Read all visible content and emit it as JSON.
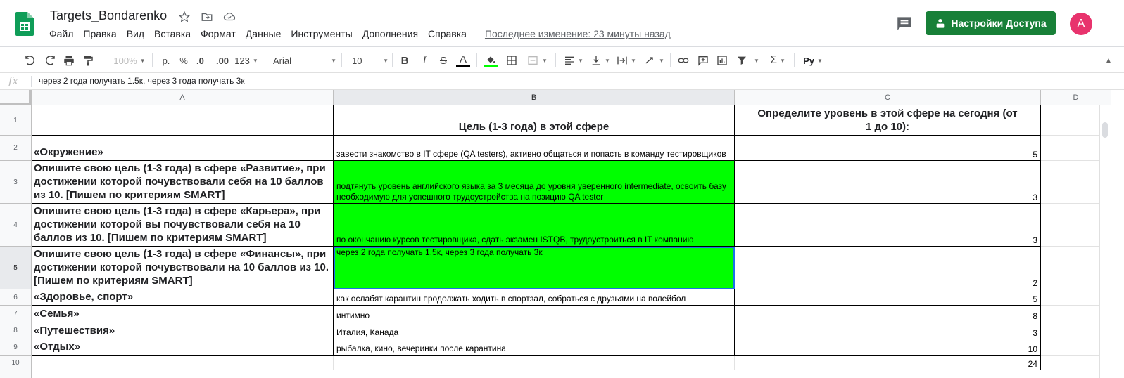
{
  "header": {
    "doc_title": "Targets_Bondarenko",
    "menus": [
      "Файл",
      "Правка",
      "Вид",
      "Вставка",
      "Формат",
      "Данные",
      "Инструменты",
      "Дополнения",
      "Справка"
    ],
    "last_edit": "Последнее изменение: 23 минуты назад",
    "share_label": "Настройки Доступа",
    "avatar_letter": "A",
    "colors": {
      "share": "#188038",
      "avatar": "#e8336d",
      "logo": "#0f9d58"
    }
  },
  "toolbar": {
    "zoom": "100%",
    "currency": "р.",
    "percent": "%",
    "dec_decrease": ".0_",
    "dec_increase": ".00",
    "more_formats": "123",
    "font": "Arial",
    "font_size": "10",
    "bold": "B",
    "italic": "I",
    "strike": "S",
    "text_color": "A",
    "input_tools": "Pу",
    "text_color_bar": "#000000",
    "fill_color_bar": "#00ff00"
  },
  "formula_bar": {
    "fx": "fx",
    "content": "через 2 года получать 1.5к, через 3 года получать 3к"
  },
  "columns": [
    "A",
    "B",
    "C",
    "D"
  ],
  "rows": [
    {
      "num": "1",
      "a": "",
      "b": "Цель (1-3 года) в этой сфере",
      "c": "Определите уровень в этой сфере на сегодня (от 1 до 10):"
    },
    {
      "num": "2",
      "a": "«Окружение»",
      "b": "завести знакомство в IT сфере (QA testers), активно общаться и попасть в команду тестировщиков",
      "c": "5"
    },
    {
      "num": "3",
      "a": "Опишите свою цель (1-3 года) в сфере «Развитие», при достижении которой почувствовали себя на 10 баллов из 10. [Пишем по критериям SMART]",
      "b": "подтянуть уровень английского языка за 3 месяца до уровня уверенного intermediate, освоить базу необходимую для успешного трудоустройства на позицию QA tester",
      "c": "3"
    },
    {
      "num": "4",
      "a": "Опишите свою цель (1-3 года) в сфере «Карьера», при достижении которой вы почувствовали себя на 10 баллов из 10. [Пишем по критериям SMART]",
      "b": "по окончанию курсов тестировщика, сдать экзамен ISTQB, трудоустроиться в IT компанию",
      "c": "3"
    },
    {
      "num": "5",
      "a": "Опишите свою цель (1-3 года) в сфере «Финансы», при достижении которой почувствовали на 10 баллов из 10. [Пишем по критериям SMART]",
      "b": "через 2 года получать 1.5к, через 3 года получать 3к",
      "c": "2"
    },
    {
      "num": "6",
      "a": "«Здоровье, спорт»",
      "b": "как ослабят карантин продолжать ходить в спортзал, собраться с друзьями на волейбол",
      "c": "5"
    },
    {
      "num": "7",
      "a": "«Семья»",
      "b": "интимно",
      "c": "8"
    },
    {
      "num": "8",
      "a": "«Путешествия»",
      "b": "Италия, Канада",
      "c": "3"
    },
    {
      "num": "9",
      "a": "«Отдых»",
      "b": "рыбалка, кино, вечеринки после карантина",
      "c": "10"
    },
    {
      "num": "10",
      "a": "",
      "b": "",
      "c": "24"
    }
  ],
  "highlight_color": "#00ff00",
  "selected_cell": "B5"
}
